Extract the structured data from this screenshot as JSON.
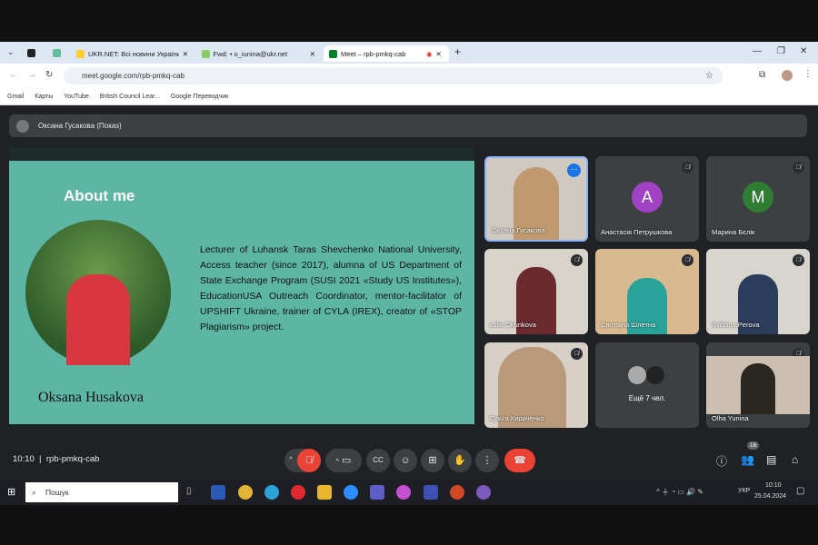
{
  "browser": {
    "tabs": [
      {
        "label": "UKR.NET: Всі новини України"
      },
      {
        "label": "Fwd: • o_iunina@ukr.net"
      },
      {
        "label": "Meet – rpb-pmkq-cab"
      }
    ],
    "url": "meet.google.com/rpb-pmkq-cab",
    "bookmarks": [
      "Gmail",
      "Карты",
      "YouTube",
      "British Council Lear...",
      "Google Переводчик"
    ]
  },
  "meet": {
    "presenter_label": "Оксана Гусакова (Показ)",
    "slide": {
      "title": "About me",
      "name": "Oksana Husakova",
      "bio": "Lecturer of Luhansk Taras Shevchenko National University, Access teacher (since 2017), alumna of US Department of State Exchange Program (SUSI 2021 «Study US Institutes»), EducationUSA Outreach Coordinator, mentor-facilitator of UPSHIFT Ukraine, trainer of CYLA (IREX), creator of «STOP Plagiarism» project."
    },
    "participants": [
      {
        "name": "Оксана Гусакова"
      },
      {
        "name": "Анастасія Петрушкова",
        "initial": "A",
        "color": "#a142c4"
      },
      {
        "name": "Марина Бєлік",
        "initial": "M",
        "color": "#2e7d32"
      },
      {
        "name": "Liliia Okunkova"
      },
      {
        "name": "Світлана Шлетна"
      },
      {
        "name": "Svitlana Perova"
      },
      {
        "name": "Ольга Кириченко"
      },
      {
        "name": "Ещё 7 чел."
      },
      {
        "name": "Olha Yunina"
      }
    ],
    "time": "10:10",
    "meeting_code": "rpb-pmkq-cab",
    "participant_count": "16"
  },
  "taskbar": {
    "search_placeholder": "Пошук",
    "lang": "УКР",
    "time": "10:10",
    "date": "25.04.2024"
  }
}
